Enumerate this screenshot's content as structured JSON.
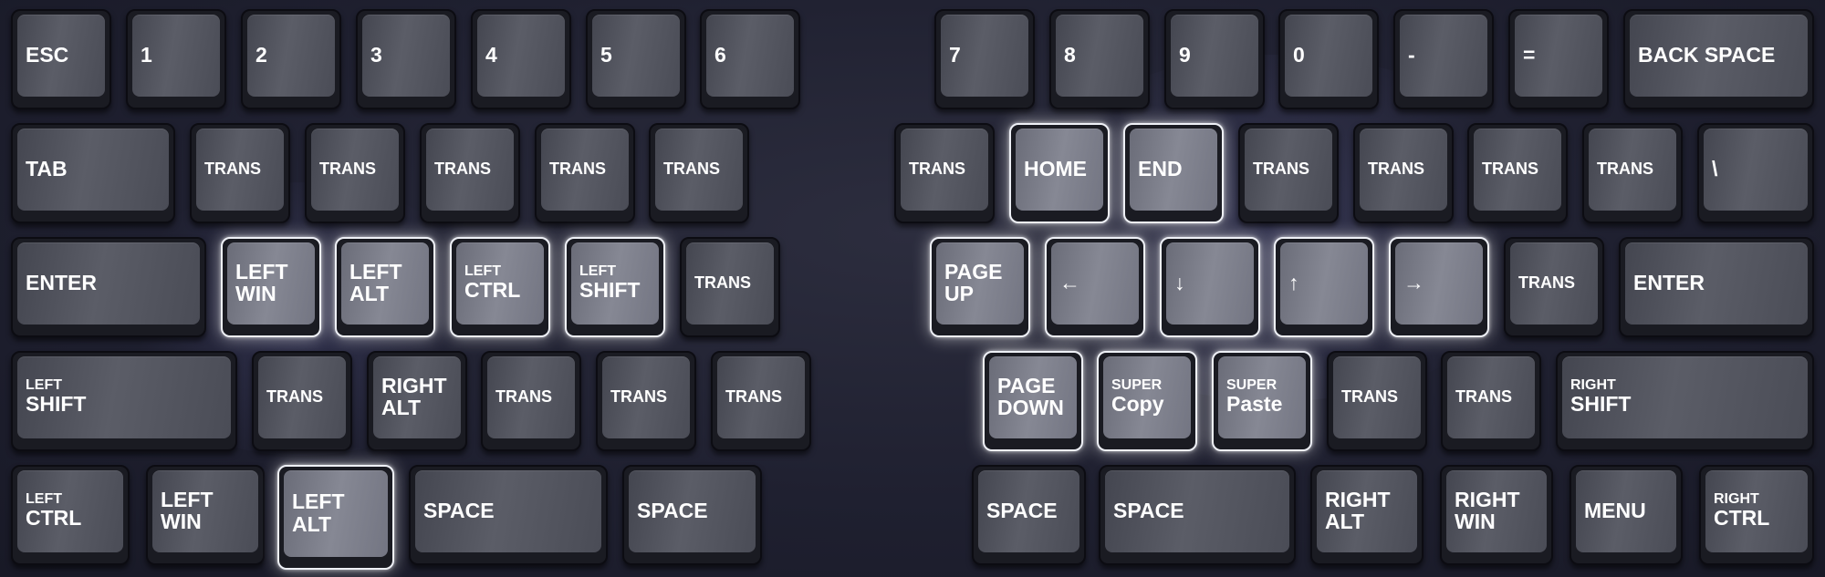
{
  "keyboard": {
    "keys": [
      {
        "id": "esc",
        "main": "ESC"
      },
      {
        "id": "1",
        "main": "1"
      },
      {
        "id": "2",
        "main": "2"
      },
      {
        "id": "3",
        "main": "3"
      },
      {
        "id": "4",
        "main": "4"
      },
      {
        "id": "5",
        "main": "5"
      },
      {
        "id": "6",
        "main": "6"
      },
      {
        "id": "7",
        "main": "7"
      },
      {
        "id": "8",
        "main": "8"
      },
      {
        "id": "9",
        "main": "9"
      },
      {
        "id": "0",
        "main": "0"
      },
      {
        "id": "minus",
        "main": "-"
      },
      {
        "id": "equals",
        "main": "="
      },
      {
        "id": "backspace",
        "main": "BACK SPACE"
      },
      {
        "id": "tab",
        "main": "TAB"
      },
      {
        "id": "trans-r2-1",
        "main": "TRANS"
      },
      {
        "id": "trans-r2-2",
        "main": "TRANS"
      },
      {
        "id": "trans-r2-3",
        "main": "TRANS"
      },
      {
        "id": "trans-r2-4",
        "main": "TRANS"
      },
      {
        "id": "trans-r2-5",
        "main": "TRANS"
      },
      {
        "id": "trans-r2-6",
        "main": "TRANS"
      },
      {
        "id": "home",
        "main": "HOME",
        "highlighted": true
      },
      {
        "id": "end",
        "main": "END",
        "highlighted": true
      },
      {
        "id": "trans-r2-7",
        "main": "TRANS"
      },
      {
        "id": "trans-r2-8",
        "main": "TRANS"
      },
      {
        "id": "trans-r2-9",
        "main": "TRANS"
      },
      {
        "id": "trans-r2-10",
        "main": "TRANS"
      },
      {
        "id": "backslash",
        "main": "\\"
      },
      {
        "id": "enter-left",
        "main": "ENTER"
      },
      {
        "id": "left-win-r3",
        "main": "LEFT",
        "main2": "WIN",
        "highlighted": true
      },
      {
        "id": "left-alt-r3",
        "main": "LEFT",
        "main2": "ALT",
        "highlighted": true
      },
      {
        "id": "left-ctrl-r3",
        "sub": "LEFT",
        "main": "CTRL",
        "highlighted": true
      },
      {
        "id": "left-shift-r3",
        "sub": "LEFT",
        "main": "SHIFT",
        "highlighted": true
      },
      {
        "id": "trans-r3-1",
        "main": "TRANS"
      },
      {
        "id": "page-up",
        "main": "PAGE",
        "main2": "UP",
        "highlighted": true
      },
      {
        "id": "arrow-left",
        "main": "←",
        "highlighted": true
      },
      {
        "id": "arrow-down",
        "main": "↓",
        "highlighted": true
      },
      {
        "id": "arrow-up",
        "main": "↑",
        "highlighted": true
      },
      {
        "id": "arrow-right",
        "main": "→",
        "highlighted": true
      },
      {
        "id": "trans-r3-2",
        "main": "TRANS"
      },
      {
        "id": "enter-right",
        "main": "ENTER"
      },
      {
        "id": "left-shift",
        "sub": "LEFT",
        "main": "SHIFT"
      },
      {
        "id": "trans-r4-1",
        "main": "TRANS"
      },
      {
        "id": "right-alt-r4",
        "main": "RIGHT",
        "main2": "ALT"
      },
      {
        "id": "trans-r4-2",
        "main": "TRANS"
      },
      {
        "id": "trans-r4-3",
        "main": "TRANS"
      },
      {
        "id": "trans-r4-4",
        "main": "TRANS"
      },
      {
        "id": "page-down",
        "main": "PAGE",
        "main2": "DOWN",
        "highlighted": true
      },
      {
        "id": "super-copy",
        "sub": "SUPER",
        "main": "Copy",
        "highlighted": true
      },
      {
        "id": "super-paste",
        "sub": "SUPER",
        "main": "Paste",
        "highlighted": true
      },
      {
        "id": "trans-r4-5",
        "main": "TRANS"
      },
      {
        "id": "trans-r4-6",
        "main": "TRANS"
      },
      {
        "id": "right-shift",
        "sub": "RIGHT",
        "main": "SHIFT"
      },
      {
        "id": "left-ctrl",
        "sub": "LEFT",
        "main": "CTRL"
      },
      {
        "id": "left-win",
        "main": "LEFT",
        "main2": "WIN"
      },
      {
        "id": "left-alt",
        "main": "LEFT",
        "main2": "ALT",
        "highlighted": true
      },
      {
        "id": "space-1",
        "main": "SPACE"
      },
      {
        "id": "space-2",
        "main": "SPACE"
      },
      {
        "id": "space-3",
        "main": "SPACE"
      },
      {
        "id": "space-4",
        "main": "SPACE"
      },
      {
        "id": "right-alt",
        "main": "RIGHT",
        "main2": "ALT"
      },
      {
        "id": "right-win",
        "main": "RIGHT",
        "main2": "WIN"
      },
      {
        "id": "menu",
        "main": "MENU"
      },
      {
        "id": "right-ctrl",
        "sub": "RIGHT",
        "main": "CTRL"
      }
    ]
  }
}
